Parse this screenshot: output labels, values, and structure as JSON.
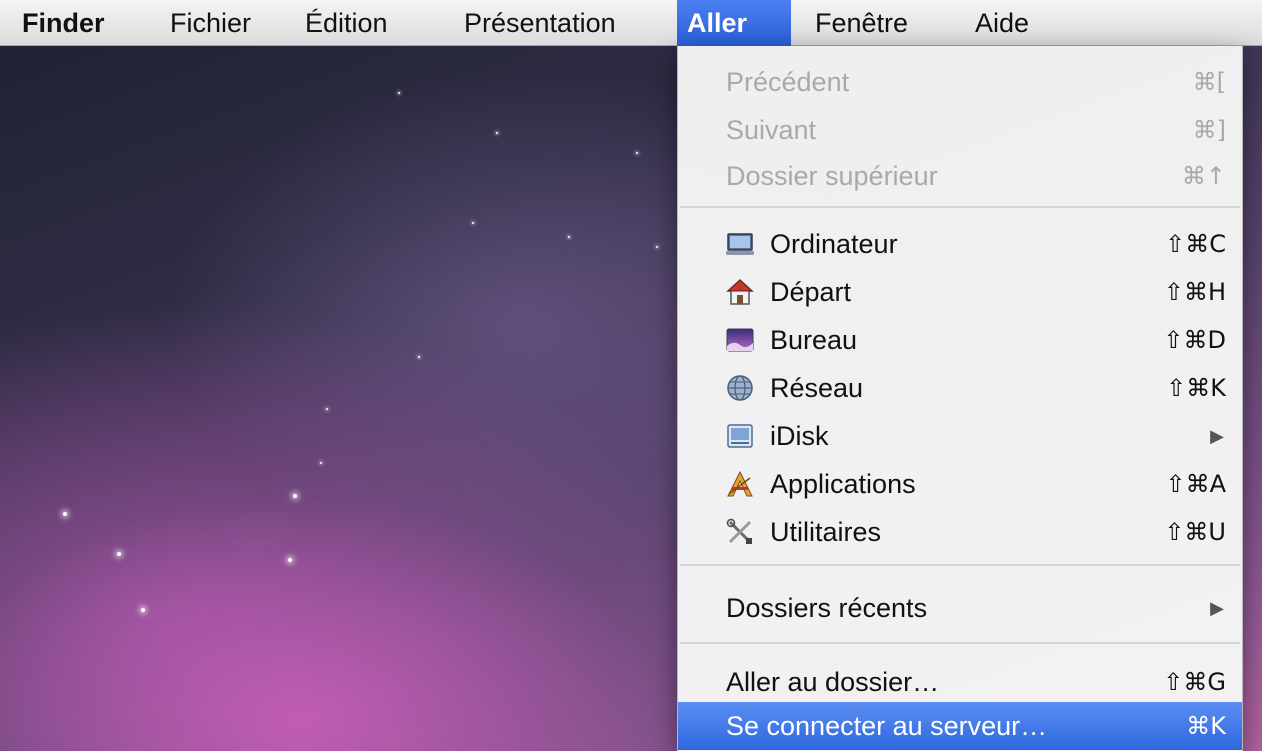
{
  "menubar": {
    "app_name": "Finder",
    "items": [
      "Fichier",
      "Édition",
      "Présentation",
      "Aller",
      "Fenêtre",
      "Aide"
    ],
    "active_item": "Aller"
  },
  "menu": {
    "nav": [
      {
        "label": "Précédent",
        "shortcut": "⌘[",
        "enabled": false
      },
      {
        "label": "Suivant",
        "shortcut": "⌘]",
        "enabled": false
      },
      {
        "label": "Dossier supérieur",
        "shortcut": "⌘↑",
        "enabled": false
      }
    ],
    "places": [
      {
        "label": "Ordinateur",
        "shortcut": "⇧⌘C",
        "icon": "computer-icon"
      },
      {
        "label": "Départ",
        "shortcut": "⇧⌘H",
        "icon": "home-icon"
      },
      {
        "label": "Bureau",
        "shortcut": "⇧⌘D",
        "icon": "desktop-icon"
      },
      {
        "label": "Réseau",
        "shortcut": "⇧⌘K",
        "icon": "network-icon"
      },
      {
        "label": "iDisk",
        "shortcut": "",
        "icon": "idisk-icon",
        "submenu": true
      },
      {
        "label": "Applications",
        "shortcut": "⇧⌘A",
        "icon": "applications-icon"
      },
      {
        "label": "Utilitaires",
        "shortcut": "⇧⌘U",
        "icon": "utilities-icon"
      }
    ],
    "recent": {
      "label": "Dossiers récents",
      "submenu": true
    },
    "goto": [
      {
        "label": "Aller au dossier…",
        "shortcut": "⇧⌘G"
      },
      {
        "label": "Se connecter au serveur…",
        "shortcut": "⌘K",
        "selected": true
      }
    ]
  },
  "colors": {
    "selection": "#2f66e0",
    "disabled_text": "#a9a9a9"
  }
}
